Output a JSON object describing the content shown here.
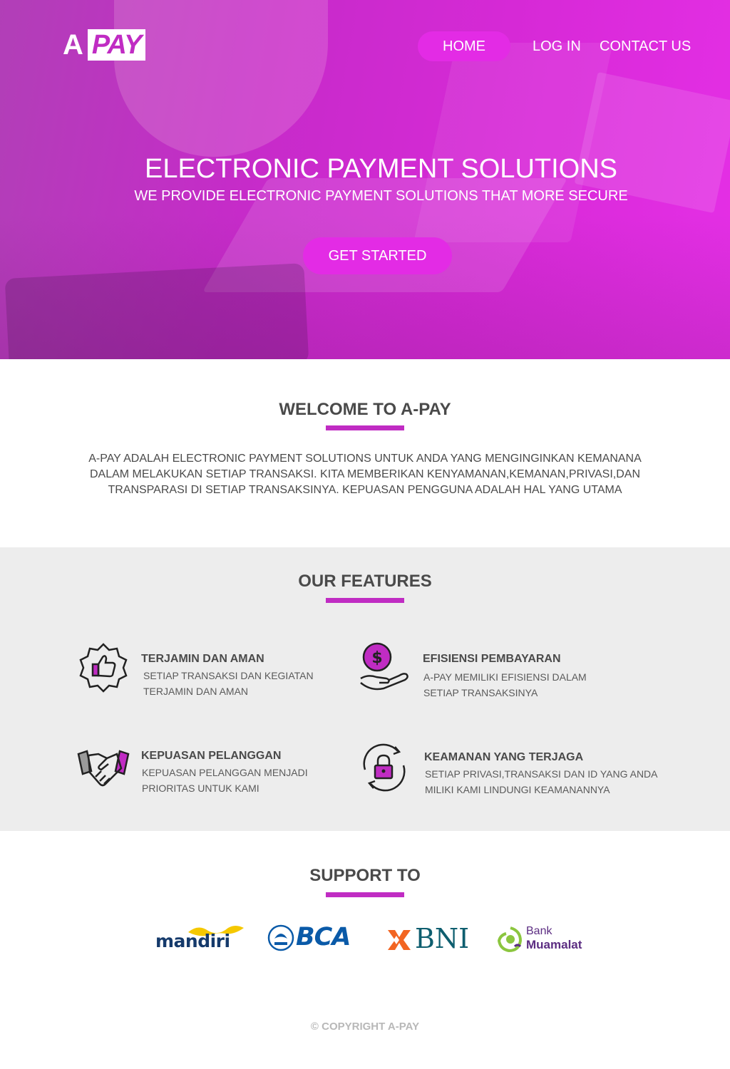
{
  "brand": {
    "logo_a": "A",
    "logo_pay": "PAY",
    "accent": "#c02cc3",
    "accent_light": "#e32be5"
  },
  "nav": {
    "home": "HOME",
    "login": "LOG IN",
    "contact": "CONTACT US"
  },
  "hero": {
    "title": "ELECTRONIC PAYMENT SOLUTIONS",
    "subtitle": "WE PROVIDE ELECTRONIC PAYMENT SOLUTIONS THAT MORE SECURE",
    "cta": "GET STARTED"
  },
  "welcome": {
    "title": "WELCOME TO A-PAY",
    "text": "A-PAY ADALAH ELECTRONIC PAYMENT SOLUTIONS UNTUK ANDA YANG MENGINGINKAN KEMANANA DALAM MELAKUKAN SETIAP TRANSAKSI. KITA MEMBERIKAN KENYAMANAN,KEMANAN,PRIVASI,DAN TRANSPARASI DI SETIAP TRANSAKSINYA. KEPUASAN PENGGUNA ADALAH HAL YANG UTAMA"
  },
  "features": {
    "title": "OUR FEATURES",
    "items": [
      {
        "icon": "thumbs-up-badge-icon",
        "title": "TERJAMIN DAN AMAN",
        "desc": "SETIAP TRANSAKSI DAN KEGIATAN TERJAMIN DAN AMAN"
      },
      {
        "icon": "hand-coin-icon",
        "title": "EFISIENSI PEMBAYARAN",
        "desc": "A-PAY MEMILIKI EFISIENSI DALAM SETIAP TRANSAKSINYA"
      },
      {
        "icon": "handshake-icon",
        "title": "KEPUASAN PELANGGAN",
        "desc": "KEPUASAN PELANGGAN MENJADI PRIORITAS UNTUK KAMI"
      },
      {
        "icon": "lock-refresh-icon",
        "title": "KEAMANAN YANG TERJAGA",
        "desc": "SETIAP PRIVASI,TRANSAKSI DAN ID YANG ANDA MILIKI KAMI LINDUNGI KEAMANANNYA"
      }
    ]
  },
  "support": {
    "title": "SUPPORT TO",
    "banks": {
      "mandiri": "mandiri",
      "bca": "BCA",
      "bni": "BNI",
      "muamalat_1": "Bank",
      "muamalat_2": "Muamalat"
    }
  },
  "footer": {
    "copyright": "© COPYRIGHT A-PAY"
  }
}
